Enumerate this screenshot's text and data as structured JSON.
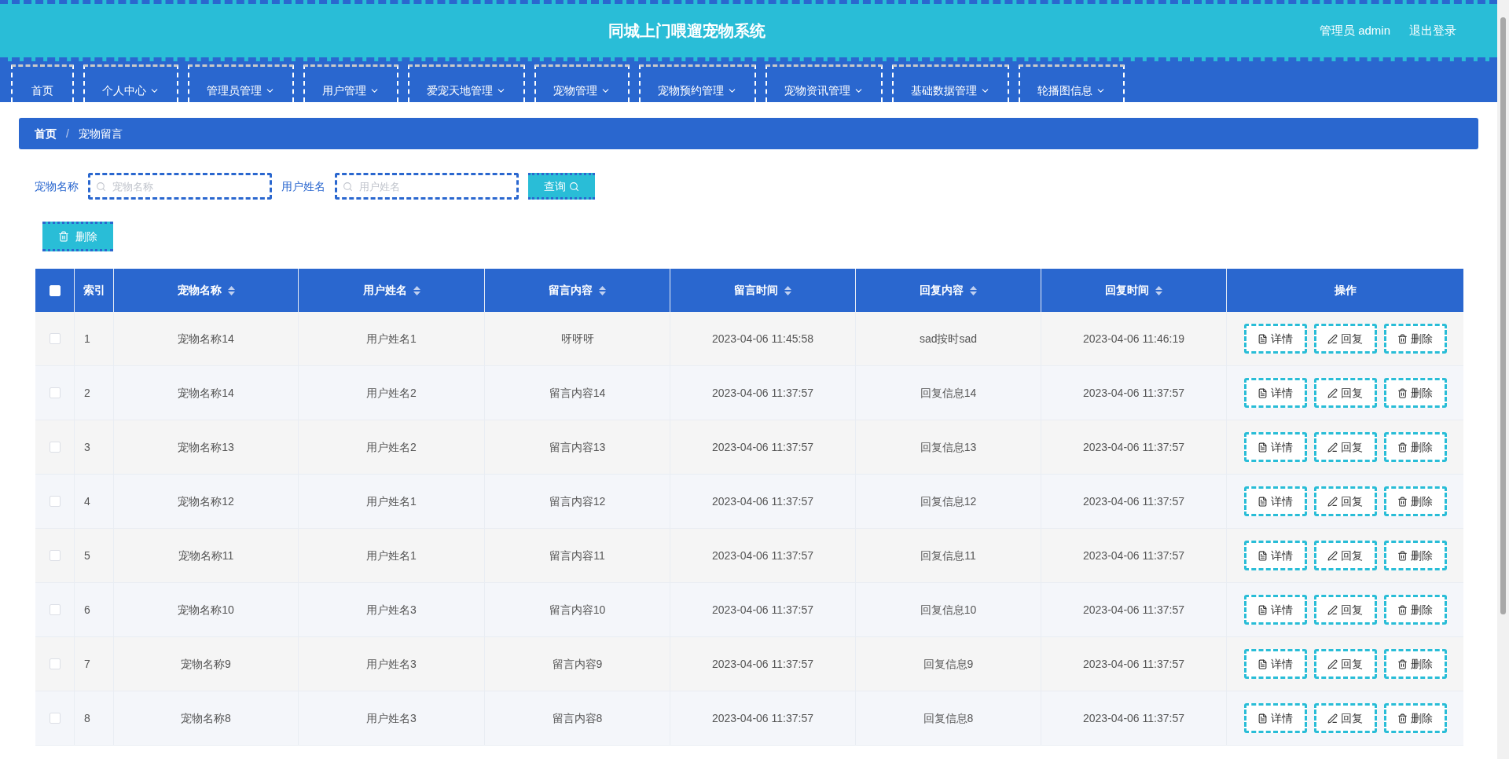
{
  "header": {
    "title": "同城上门喂遛宠物系统",
    "user": "管理员 admin",
    "logout": "退出登录"
  },
  "nav": [
    {
      "label": "首页",
      "dropdown": false
    },
    {
      "label": "个人中心",
      "dropdown": true
    },
    {
      "label": "管理员管理",
      "dropdown": true
    },
    {
      "label": "用户管理",
      "dropdown": true
    },
    {
      "label": "爱宠天地管理",
      "dropdown": true
    },
    {
      "label": "宠物管理",
      "dropdown": true
    },
    {
      "label": "宠物预约管理",
      "dropdown": true
    },
    {
      "label": "宠物资讯管理",
      "dropdown": true
    },
    {
      "label": "基础数据管理",
      "dropdown": true
    },
    {
      "label": "轮播图信息",
      "dropdown": true
    }
  ],
  "breadcrumb": {
    "items": [
      "首页",
      "宠物留言"
    ],
    "separator": "/"
  },
  "search": [
    {
      "label": "宠物名称",
      "placeholder": "宠物名称"
    },
    {
      "label": "用户姓名",
      "placeholder": "用户姓名"
    }
  ],
  "query_button": "查询",
  "delete_button": "删除",
  "table": {
    "header_checkbox": {
      "checked": false
    },
    "columns": [
      {
        "label": "索引",
        "sortable": false
      },
      {
        "label": "宠物名称",
        "sortable": true
      },
      {
        "label": "用户姓名",
        "sortable": true
      },
      {
        "label": "留言内容",
        "sortable": true
      },
      {
        "label": "留言时间",
        "sortable": true
      },
      {
        "label": "回复内容",
        "sortable": true
      },
      {
        "label": "回复时间",
        "sortable": true
      },
      {
        "label": "操作",
        "sortable": false
      }
    ],
    "rows": [
      {
        "checked": false,
        "cells": [
          "1",
          "宠物名称14",
          "用户姓名1",
          "呀呀呀",
          "2023-04-06 11:45:58",
          "sad按时sad",
          "2023-04-06 11:46:19"
        ],
        "actions": [
          "详情",
          "回复",
          "删除"
        ]
      },
      {
        "checked": false,
        "cells": [
          "2",
          "宠物名称14",
          "用户姓名2",
          "留言内容14",
          "2023-04-06 11:37:57",
          "回复信息14",
          "2023-04-06 11:37:57"
        ],
        "actions": [
          "详情",
          "回复",
          "删除"
        ]
      },
      {
        "checked": false,
        "cells": [
          "3",
          "宠物名称13",
          "用户姓名2",
          "留言内容13",
          "2023-04-06 11:37:57",
          "回复信息13",
          "2023-04-06 11:37:57"
        ],
        "actions": [
          "详情",
          "回复",
          "删除"
        ]
      },
      {
        "checked": false,
        "cells": [
          "4",
          "宠物名称12",
          "用户姓名1",
          "留言内容12",
          "2023-04-06 11:37:57",
          "回复信息12",
          "2023-04-06 11:37:57"
        ],
        "actions": [
          "详情",
          "回复",
          "删除"
        ]
      },
      {
        "checked": false,
        "cells": [
          "5",
          "宠物名称11",
          "用户姓名1",
          "留言内容11",
          "2023-04-06 11:37:57",
          "回复信息11",
          "2023-04-06 11:37:57"
        ],
        "actions": [
          "详情",
          "回复",
          "删除"
        ]
      },
      {
        "checked": false,
        "cells": [
          "6",
          "宠物名称10",
          "用户姓名3",
          "留言内容10",
          "2023-04-06 11:37:57",
          "回复信息10",
          "2023-04-06 11:37:57"
        ],
        "actions": [
          "详情",
          "回复",
          "删除"
        ]
      },
      {
        "checked": false,
        "cells": [
          "7",
          "宠物名称9",
          "用户姓名3",
          "留言内容9",
          "2023-04-06 11:37:57",
          "回复信息9",
          "2023-04-06 11:37:57"
        ],
        "actions": [
          "详情",
          "回复",
          "删除"
        ]
      },
      {
        "checked": false,
        "cells": [
          "8",
          "宠物名称8",
          "用户姓名3",
          "留言内容8",
          "2023-04-06 11:37:57",
          "回复信息8",
          "2023-04-06 11:37:57"
        ],
        "actions": [
          "详情",
          "回复",
          "删除"
        ]
      }
    ]
  }
}
